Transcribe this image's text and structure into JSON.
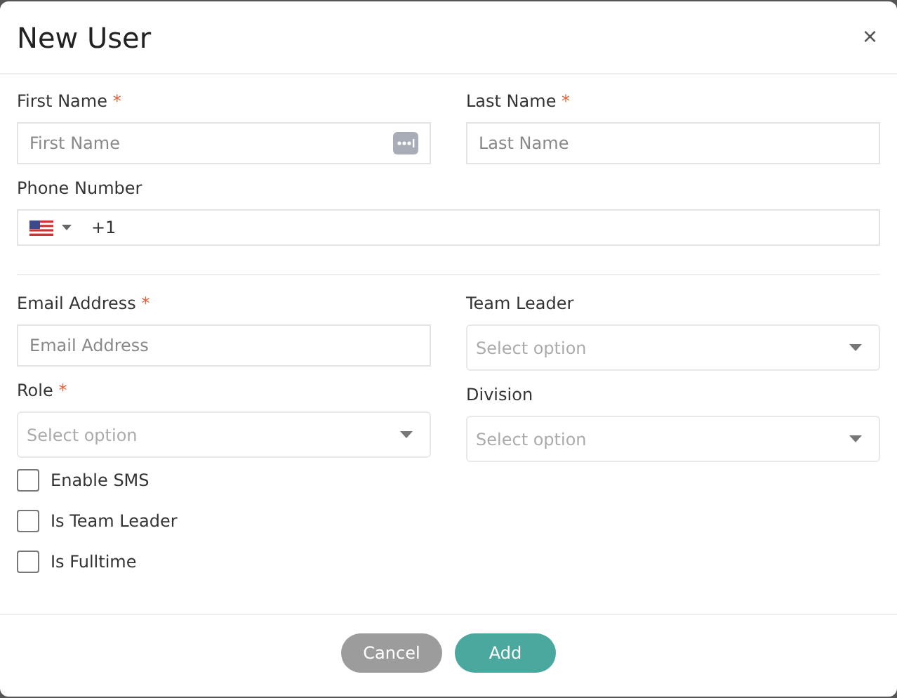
{
  "dialog": {
    "title": "New User",
    "close": "×"
  },
  "first_name": {
    "label": "First Name",
    "required_mark": "*",
    "placeholder": "First Name"
  },
  "last_name": {
    "label": "Last Name",
    "required_mark": "*",
    "placeholder": "Last Name"
  },
  "phone": {
    "label": "Phone Number",
    "value": "+1"
  },
  "email": {
    "label": "Email Address",
    "required_mark": "*",
    "placeholder": "Email Address"
  },
  "role": {
    "label": "Role",
    "required_mark": "*",
    "placeholder": "Select option"
  },
  "team_leader": {
    "label": "Team Leader",
    "placeholder": "Select option"
  },
  "division": {
    "label": "Division",
    "placeholder": "Select option"
  },
  "checkboxes": [
    {
      "label": "Enable SMS",
      "checked": false
    },
    {
      "label": "Is Team Leader",
      "checked": false
    },
    {
      "label": "Is Fulltime",
      "checked": false
    }
  ],
  "buttons": [
    {
      "label": "Cancel",
      "kind": "secondary"
    },
    {
      "label": "Add",
      "kind": "primary"
    }
  ]
}
